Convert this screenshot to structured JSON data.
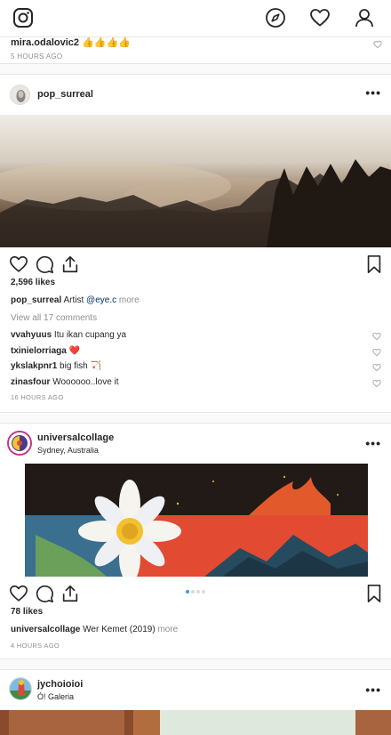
{
  "prev_post": {
    "username": "mira.odalovic2",
    "comment": "👍👍👍👍",
    "timestamp": "5 HOURS AGO"
  },
  "posts": [
    {
      "username": "pop_surreal",
      "likes": "2,596 likes",
      "caption_user": "pop_surreal",
      "caption_text": "Artist",
      "caption_link": "@eye.c",
      "caption_more": "more",
      "view_all": "View all 17 comments",
      "comments": [
        {
          "user": "vvahyuus",
          "text": "Itu ikan cupang ya"
        },
        {
          "user": "txinielorriaga",
          "text": "❤️"
        },
        {
          "user": "ykslakpnr1",
          "text": "big fish 🏹"
        },
        {
          "user": "zinasfour",
          "text": "Woooooo..love it"
        }
      ],
      "timestamp": "16 HOURS AGO"
    },
    {
      "username": "universalcollage",
      "location": "Sydney, Australia",
      "likes": "78 likes",
      "caption_user": "universalcollage",
      "caption_text": "Wer Kemet (2019)",
      "caption_more": "more",
      "timestamp": "4 HOURS AGO",
      "carousel_count": 4,
      "carousel_active": 1
    },
    {
      "username": "jychoioioi",
      "location": "Ó! Galeria"
    }
  ],
  "colors": {
    "link": "#003569",
    "muted": "#8e8e8e",
    "carousel_active": "#3897f0"
  }
}
